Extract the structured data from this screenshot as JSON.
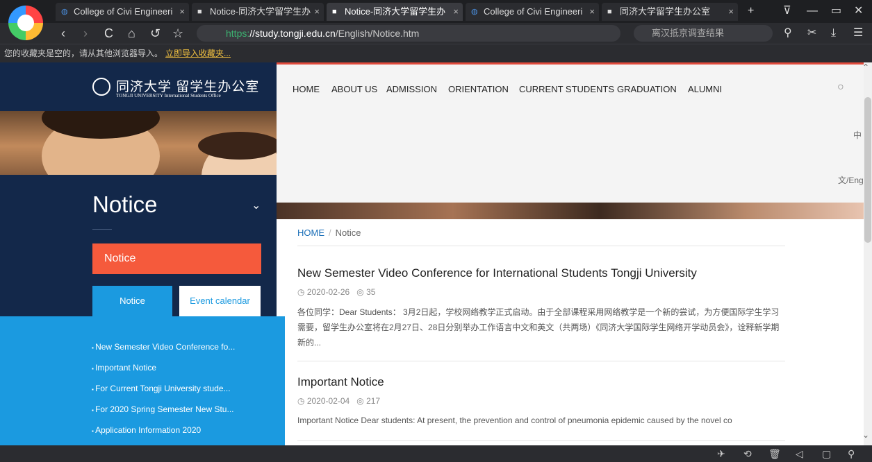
{
  "browser": {
    "tabs": [
      {
        "label": "College of Civi Engineeri",
        "close": "×"
      },
      {
        "label": "Notice-同济大学留学生办",
        "close": "×"
      },
      {
        "label": "Notice-同济大学留学生办",
        "close": "×"
      },
      {
        "label": "College of Civi Engineeri",
        "close": "×"
      },
      {
        "label": "同济大学留学生办公室",
        "close": "×"
      }
    ],
    "new_tab": "+",
    "window_buttons": [
      "⊽",
      "—",
      "▭",
      "✕"
    ],
    "nav": {
      "back": "‹",
      "forward": "›",
      "reload": "C",
      "home": "⌂",
      "undo": "↺",
      "star": "☆"
    },
    "url": {
      "proto": "https:",
      "host": "//study.tongji.edu.cn",
      "path": "/English/Notice.htm"
    },
    "search_placeholder": "离汉抵京调查结果",
    "toolbar_icons": [
      "⚲",
      "✂",
      "⤓",
      "☰"
    ],
    "bookmark_notice": "您的收藏夹是空的，请从其他浏览器导入。",
    "bookmark_link": "立即导入收藏夹..."
  },
  "sidebar": {
    "brand_cn": "同济大学 留学生办公室",
    "brand_en": "TONGJI UNIVERSITY   International Students Office",
    "title": "Notice",
    "chevron": "⌄",
    "active_label": "Notice",
    "tabs": [
      "Notice",
      "Event calendar"
    ],
    "list": [
      "New Semester Video Conference fo...",
      "Important Notice",
      "For Current Tongji University stude...",
      "For 2020 Spring Semester New Stu...",
      "Application Information 2020"
    ]
  },
  "topnav": {
    "items": [
      "HOME",
      "ABOUT US",
      "ADMISSION",
      "ORIENTATION",
      "CURRENT STUDENTS",
      "GRADUATION",
      "ALUMNI"
    ],
    "search_icon": "○",
    "lang_a": "中",
    "lang_b": "文/Eng"
  },
  "breadcrumb": {
    "home": "HOME",
    "sep": "/",
    "current": "Notice"
  },
  "notices": [
    {
      "title": "New Semester Video Conference for International Students Tongji University",
      "date": "2020-02-26",
      "views": "35",
      "body": "各位同学：Dear Students： 3月2日起，学校网络教学正式启动。由于全部课程采用网络教学是一个新的尝试，为方便国际学生学习需要，留学生办公室将在2月27日、28日分别举办工作语言中文和英文（共两场）《同济大学国际学生网络开学动员会》，诠释新学期新的..."
    },
    {
      "title": "Important Notice",
      "date": "2020-02-04",
      "views": "217",
      "body": "Important Notice Dear students:  At present, the prevention and control of pneumonia epidemic caused by the novel co"
    }
  ],
  "icons": {
    "clock": "◷",
    "eye": "◎"
  },
  "statusbar_icons": [
    "✈",
    "⟲",
    "🗑",
    "◁",
    "▢",
    "⚲"
  ],
  "colors": {
    "accent_red": "#f55a3c",
    "accent_blue": "#1b9ae0",
    "sidebar_navy": "#13284a"
  }
}
